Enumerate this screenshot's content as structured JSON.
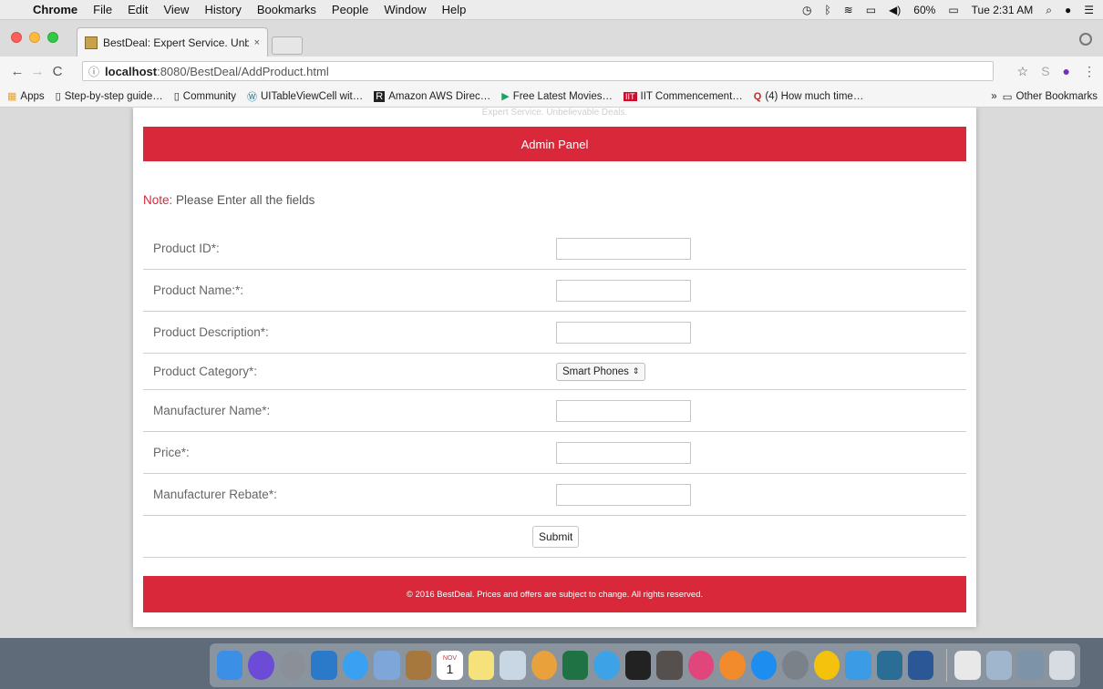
{
  "menubar": {
    "app": "Chrome",
    "items": [
      "File",
      "Edit",
      "View",
      "History",
      "Bookmarks",
      "People",
      "Window",
      "Help"
    ],
    "battery": "60%",
    "clock": "Tue 2:31 AM"
  },
  "tab": {
    "title": "BestDeal: Expert Service. Unbe",
    "close": "×"
  },
  "omnibox": {
    "host": "localhost",
    "path": ":8080/BestDeal/AddProduct.html"
  },
  "bookmarks": {
    "items": [
      "Apps",
      "Step-by-step guide…",
      "Community",
      "UITableViewCell wit…",
      "Amazon AWS Direc…",
      "Free Latest Movies…",
      "IIT Commencement…",
      "(4) How much time…"
    ],
    "other": "Other Bookmarks"
  },
  "page": {
    "tagline": "Expert Service. Unbelievable Deals.",
    "panel_title": "Admin Panel",
    "note_label": "Note:",
    "note_text": " Please Enter all the fields",
    "fields": [
      {
        "label": "Product ID*:",
        "value": ""
      },
      {
        "label": "Product Name:*:",
        "value": ""
      },
      {
        "label": "Product Description*:",
        "value": ""
      },
      {
        "label": "Product Category*:",
        "selected": "Smart Phones"
      },
      {
        "label": "Manufacturer Name*:",
        "value": ""
      },
      {
        "label": "Price*:",
        "value": ""
      },
      {
        "label": "Manufacturer Rebate*:",
        "value": ""
      }
    ],
    "submit": "Submit",
    "footer": "© 2016 BestDeal. Prices and offers are subject to change. All rights reserved."
  },
  "colors": {
    "brand_red": "#d8283a"
  },
  "dock": {
    "calendar_month": "NOV",
    "calendar_day": "1"
  }
}
